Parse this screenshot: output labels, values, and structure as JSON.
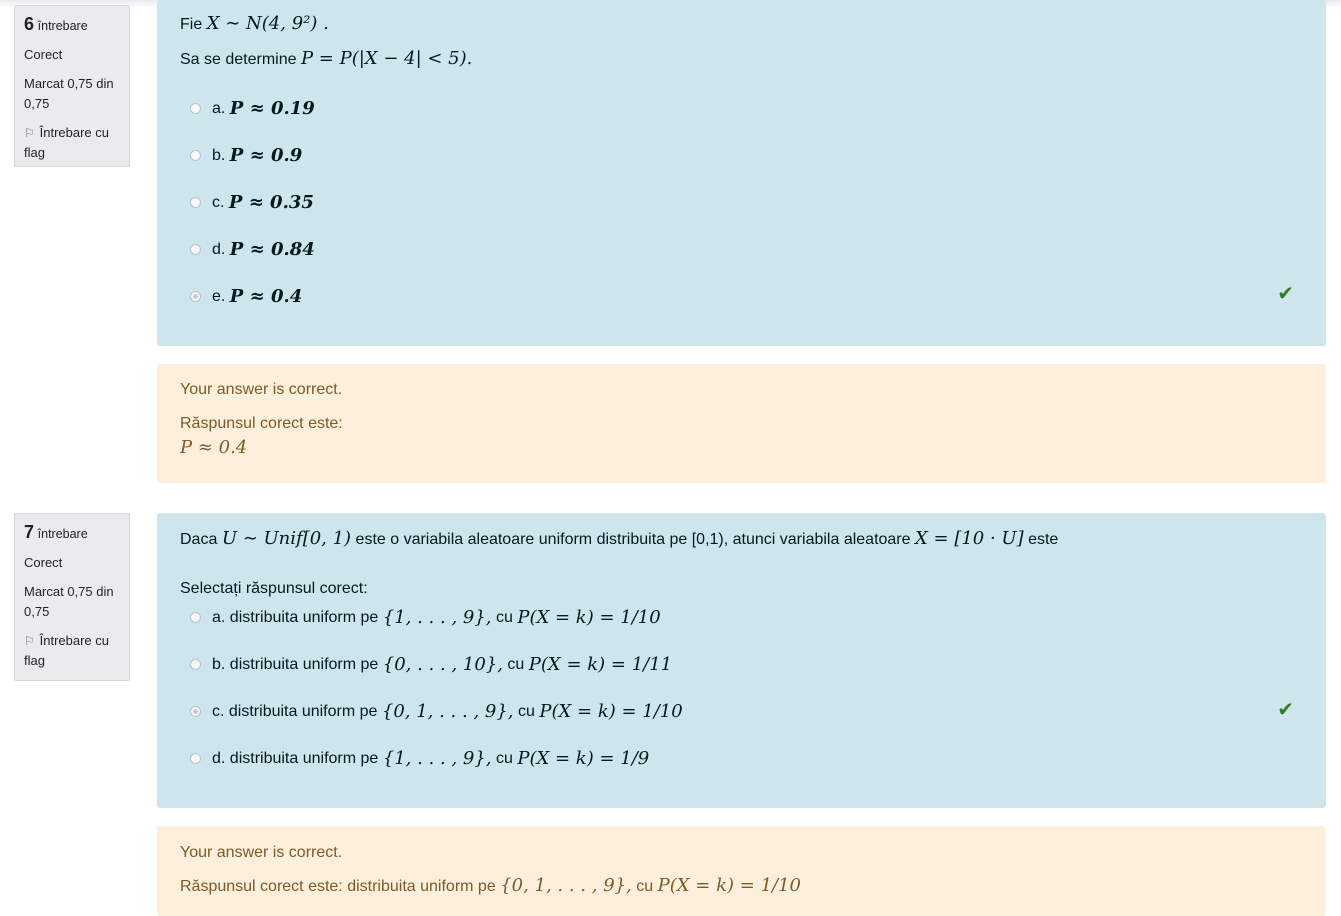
{
  "q6": {
    "info": {
      "number": "6",
      "label": "întrebare",
      "status": "Corect",
      "mark_line1": "Marcat 0,75 din",
      "mark_line2": "0,75",
      "flag_line1": "Întrebare cu",
      "flag_line2": "flag"
    },
    "text_prefix": "Fie",
    "text_math": "X ∼ N(4, 9²) .",
    "prompt_prefix": "Sa se determine",
    "prompt_math": "P = P(|X − 4| < 5).",
    "options": [
      {
        "letter": "a.",
        "math": "P ≈ 0.19"
      },
      {
        "letter": "b.",
        "math": "P ≈ 0.9"
      },
      {
        "letter": "c.",
        "math": "P ≈ 0.35"
      },
      {
        "letter": "d.",
        "math": "P ≈ 0.84"
      },
      {
        "letter": "e.",
        "math": "P ≈ 0.4"
      }
    ],
    "selected": "e",
    "feedback": {
      "correct_msg": "Your answer is correct.",
      "right_label": "Răspunsul corect este:",
      "right_math": "P ≈ 0.4"
    }
  },
  "q7": {
    "info": {
      "number": "7",
      "label": "întrebare",
      "status": "Corect",
      "mark_line1": "Marcat 0,75 din",
      "mark_line2": "0,75",
      "flag_line1": "Întrebare cu",
      "flag_line2": "flag"
    },
    "text_prefix": "Daca",
    "text_math1": "U ∼ Unif[0, 1)",
    "text_middle": "este o variabila aleatoare uniform distribuita pe [0,1), atunci variabila aleatoare",
    "text_math2": "X = [10 · U]",
    "text_suffix": "este",
    "instruction": "Selectați răspunsul corect:",
    "options": [
      {
        "letter": "a.",
        "text": "distribuita uniform pe",
        "set": "{1, . . . , 9},",
        "cu": "cu",
        "prob": "P(X = k) = 1/10"
      },
      {
        "letter": "b.",
        "text": "distribuita uniform pe",
        "set": "{0, . . . , 10},",
        "cu": "cu",
        "prob": "P(X = k) = 1/11"
      },
      {
        "letter": "c.",
        "text": "distribuita uniform pe",
        "set": "{0, 1, . . . , 9},",
        "cu": "cu",
        "prob": "P(X = k) = 1/10"
      },
      {
        "letter": "d.",
        "text": "distribuita uniform pe",
        "set": "{1, . . . , 9},",
        "cu": "cu",
        "prob": "P(X = k) = 1/9"
      }
    ],
    "selected": "c",
    "feedback": {
      "correct_msg": "Your answer is correct.",
      "right_label": "Răspunsul corect este: distribuita uniform pe",
      "right_set": "{0, 1, . . . , 9},",
      "right_cu": "cu",
      "right_prob": "P(X = k) = 1/10"
    }
  },
  "icons": {
    "check": "check-icon",
    "flag": "flag-icon",
    "radio": "radio-icon"
  },
  "colors": {
    "question_bg": "#cee6eb",
    "feedback_bg": "#fcefdc",
    "check": "#357a32",
    "info_bg": "#e9ecef"
  }
}
